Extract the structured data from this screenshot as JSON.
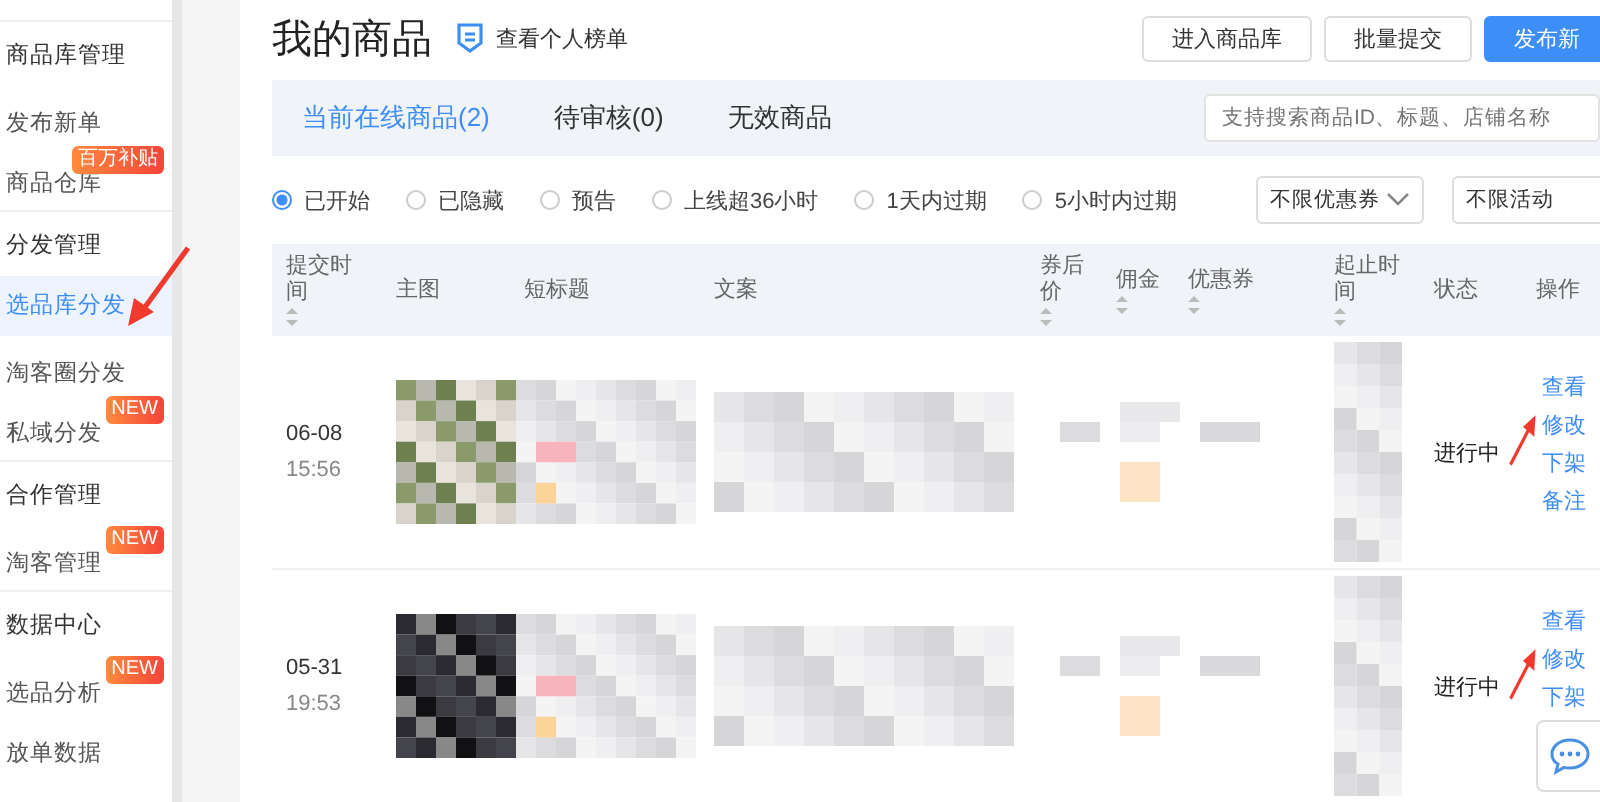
{
  "sidebar": {
    "groups": [
      {
        "title": "商品库管理",
        "items": [
          {
            "label": "发布新单",
            "selected": false
          },
          {
            "label": "商品仓库",
            "selected": false,
            "badge": "百万补贴"
          }
        ]
      },
      {
        "title": "分发管理",
        "items": [
          {
            "label": "选品库分发",
            "selected": true
          },
          {
            "label": "淘客圈分发",
            "selected": false
          },
          {
            "label": "私域分发",
            "selected": false,
            "badge": "NEW"
          }
        ]
      },
      {
        "title": "合作管理",
        "items": [
          {
            "label": "淘客管理",
            "selected": false,
            "badge": "NEW"
          }
        ]
      },
      {
        "title": "数据中心",
        "items": [
          {
            "label": "选品分析",
            "selected": false,
            "badge": "NEW"
          },
          {
            "label": "放单数据",
            "selected": false
          }
        ]
      }
    ]
  },
  "header": {
    "title": "我的商品",
    "link": "查看个人榜单",
    "buttons": [
      {
        "label": "进入商品库",
        "kind": "default"
      },
      {
        "label": "批量提交",
        "kind": "default"
      },
      {
        "label": "发布新",
        "kind": "primary"
      }
    ]
  },
  "tabs": [
    {
      "label": "当前在线商品(2)",
      "selected": true
    },
    {
      "label": "待审核(0)",
      "selected": false
    },
    {
      "label": "无效商品",
      "selected": false
    }
  ],
  "search": {
    "placeholder": "支持搜索商品ID、标题、店铺名称"
  },
  "filters": [
    {
      "label": "已开始",
      "selected": true
    },
    {
      "label": "已隐藏",
      "selected": false
    },
    {
      "label": "预告",
      "selected": false
    },
    {
      "label": "上线超36小时",
      "selected": false
    },
    {
      "label": "1天内过期",
      "selected": false
    },
    {
      "label": "5小时内过期",
      "selected": false
    }
  ],
  "dropdowns": [
    {
      "value": "不限优惠券"
    },
    {
      "value": "不限活动"
    }
  ],
  "table": {
    "columns": [
      {
        "label": "提交时间",
        "sortable": true
      },
      {
        "label": "主图",
        "sortable": false
      },
      {
        "label": "短标题",
        "sortable": false
      },
      {
        "label": "文案",
        "sortable": false
      },
      {
        "label": "券后价",
        "sortable": true
      },
      {
        "label": "佣金",
        "sortable": true
      },
      {
        "label": "优惠券",
        "sortable": true
      },
      {
        "label": "起止时间",
        "sortable": true
      },
      {
        "label": "状态",
        "sortable": false
      },
      {
        "label": "操作",
        "sortable": false
      }
    ],
    "rows": [
      {
        "date": "06-08",
        "time": "15:56",
        "status": "进行中",
        "actions": [
          "查看",
          "修改",
          "下架",
          "备注"
        ]
      },
      {
        "date": "05-31",
        "time": "19:53",
        "status": "进行中",
        "actions": [
          "查看",
          "修改",
          "下架"
        ]
      }
    ]
  }
}
